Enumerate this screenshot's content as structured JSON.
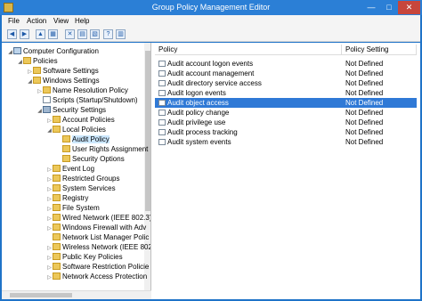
{
  "window": {
    "title": "Group Policy Management Editor",
    "controls": {
      "minimize": "—",
      "maximize": "□",
      "close": "✕"
    }
  },
  "menubar": {
    "items": [
      "File",
      "Action",
      "View",
      "Help"
    ]
  },
  "toolbar": {
    "buttons": [
      {
        "name": "back-icon",
        "glyph": "◀"
      },
      {
        "name": "forward-icon",
        "glyph": "▶"
      },
      {
        "name": "up-folder-icon",
        "glyph": "▲"
      },
      {
        "name": "show-hide-tree-icon",
        "glyph": "▦"
      },
      {
        "name": "delete-icon",
        "glyph": "✕"
      },
      {
        "name": "properties-icon",
        "glyph": "▤"
      },
      {
        "name": "export-list-icon",
        "glyph": "▧"
      },
      {
        "name": "help-icon",
        "glyph": "?"
      },
      {
        "name": "show-hide-action-pane-icon",
        "glyph": "▥"
      }
    ]
  },
  "tree": {
    "items": [
      {
        "label": "Computer Configuration",
        "expander": "◢",
        "icon": "pc"
      },
      {
        "label": "Policies",
        "expander": "◢",
        "icon": "folder"
      },
      {
        "label": "Software Settings",
        "expander": "▷",
        "icon": "folder"
      },
      {
        "label": "Windows Settings",
        "expander": "◢",
        "icon": "folder"
      },
      {
        "label": "Name Resolution Policy",
        "expander": "▷",
        "icon": "folder"
      },
      {
        "label": "Scripts (Startup/Shutdown)",
        "expander": "",
        "icon": "doc"
      },
      {
        "label": "Security Settings",
        "expander": "◢",
        "icon": "sec"
      },
      {
        "label": "Account Policies",
        "expander": "▷",
        "icon": "folder"
      },
      {
        "label": "Local Policies",
        "expander": "◢",
        "icon": "folder"
      },
      {
        "label": "Audit Policy",
        "expander": "",
        "icon": "folder"
      },
      {
        "label": "User Rights Assignment",
        "expander": "",
        "icon": "folder"
      },
      {
        "label": "Security Options",
        "expander": "",
        "icon": "folder"
      },
      {
        "label": "Event Log",
        "expander": "▷",
        "icon": "folder"
      },
      {
        "label": "Restricted Groups",
        "expander": "▷",
        "icon": "folder"
      },
      {
        "label": "System Services",
        "expander": "▷",
        "icon": "folder"
      },
      {
        "label": "Registry",
        "expander": "▷",
        "icon": "folder"
      },
      {
        "label": "File System",
        "expander": "▷",
        "icon": "folder"
      },
      {
        "label": "Wired Network (IEEE 802.3)",
        "expander": "▷",
        "icon": "folder"
      },
      {
        "label": "Windows Firewall with Adv",
        "expander": "▷",
        "icon": "folder"
      },
      {
        "label": "Network List Manager Polic",
        "expander": "",
        "icon": "folder"
      },
      {
        "label": "Wireless Network (IEEE 802.",
        "expander": "▷",
        "icon": "folder"
      },
      {
        "label": "Public Key Policies",
        "expander": "▷",
        "icon": "folder"
      },
      {
        "label": "Software Restriction Policie",
        "expander": "▷",
        "icon": "folder"
      },
      {
        "label": "Network Access Protection",
        "expander": "▷",
        "icon": "folder"
      }
    ]
  },
  "list": {
    "headers": {
      "policy": "Policy",
      "setting": "Policy Setting"
    },
    "rows": [
      {
        "policy": "Audit account logon events",
        "setting": "Not Defined"
      },
      {
        "policy": "Audit account management",
        "setting": "Not Defined"
      },
      {
        "policy": "Audit directory service access",
        "setting": "Not Defined"
      },
      {
        "policy": "Audit logon events",
        "setting": "Not Defined"
      },
      {
        "policy": "Audit object access",
        "setting": "Not Defined"
      },
      {
        "policy": "Audit policy change",
        "setting": "Not Defined"
      },
      {
        "policy": "Audit privilege use",
        "setting": "Not Defined"
      },
      {
        "policy": "Audit process tracking",
        "setting": "Not Defined"
      },
      {
        "policy": "Audit system events",
        "setting": "Not Defined"
      }
    ]
  }
}
